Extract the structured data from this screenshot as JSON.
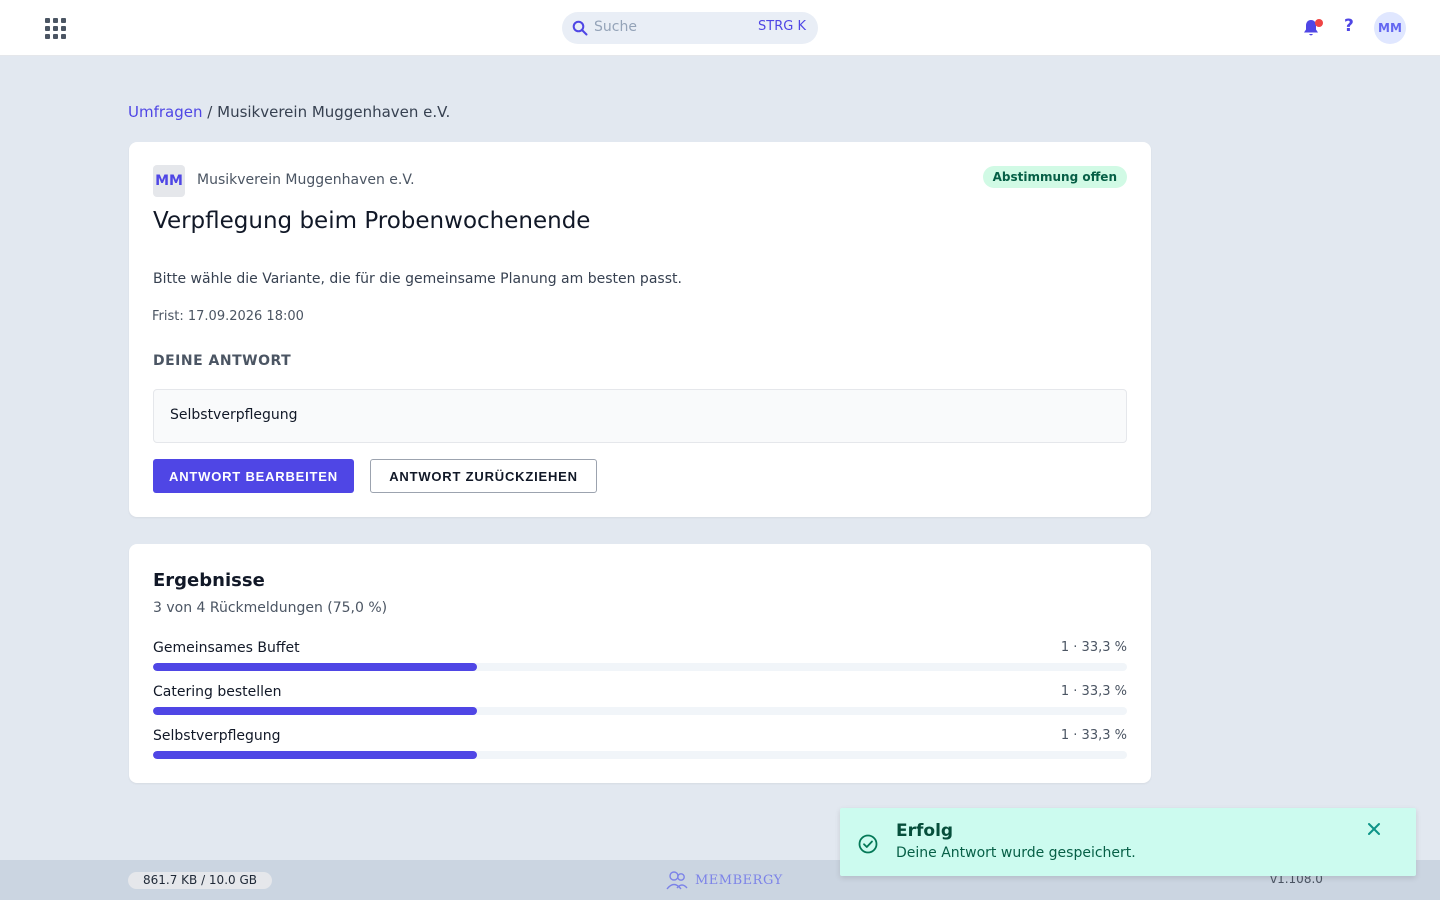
{
  "topbar": {
    "apps_icon": "grid-icon",
    "search": {
      "placeholder": "Suche",
      "shortcut": "STRG K"
    },
    "help_label": "?",
    "user_initials": "MM"
  },
  "breadcrumb": {
    "parent": "Umfragen",
    "separator": "/",
    "current": "Musikverein Muggenhaven e.V."
  },
  "survey": {
    "org_initials": "MM",
    "org_name": "Musikverein Muggenhaven e.V.",
    "status": "Abstimmung offen",
    "title": "Verpflegung beim Probenwochenende",
    "description": "Bitte wähle die Variante, die für die gemeinsame Planung am besten passt.",
    "deadline": "Frist: 17.09.2026 18:00",
    "answer_section_label": "DEINE ANTWORT",
    "answer_value": "Selbstverpflegung",
    "edit_button": "ANTWORT BEARBEITEN",
    "withdraw_button": "ANTWORT ZURÜCKZIEHEN"
  },
  "results": {
    "title": "Ergebnisse",
    "summary": "3 von 4 Rückmeldungen (75,0 %)",
    "options": [
      {
        "label": "Gemeinsames Buffet",
        "value": "1 · 33,3 %",
        "fraction": 0.333
      },
      {
        "label": "Catering bestellen",
        "value": "1 · 33,3 %",
        "fraction": 0.333
      },
      {
        "label": "Selbstverpflegung",
        "value": "1 · 33,3 %",
        "fraction": 0.333
      }
    ]
  },
  "footer": {
    "storage": "861.7 KB / 10.0 GB",
    "brand": "MEMBERGY",
    "version": "v1.108.0"
  },
  "toast": {
    "title": "Erfolg",
    "message": "Deine Antwort wurde gespeichert."
  },
  "colors": {
    "accent": "#4f46e5",
    "background": "#e2e8f0",
    "status_badge_bg": "#d1fae5",
    "toast_bg": "#ccfbef"
  }
}
